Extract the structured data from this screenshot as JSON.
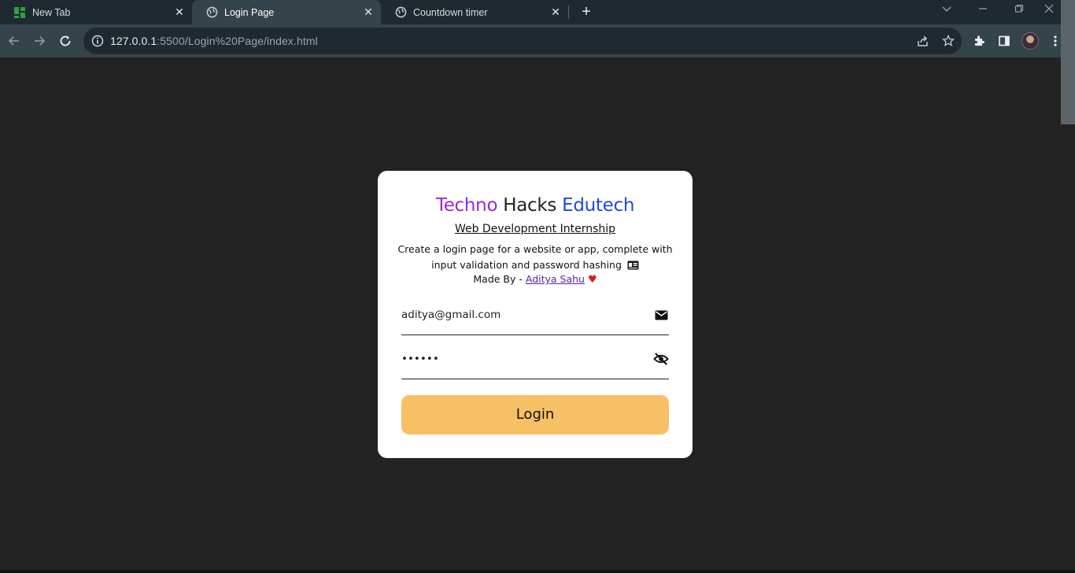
{
  "browser": {
    "tabs": [
      {
        "title": "New Tab",
        "icon": "grid-icon"
      },
      {
        "title": "Login Page",
        "icon": "globe-icon",
        "active": true
      },
      {
        "title": "Countdown timer",
        "icon": "globe-icon"
      }
    ],
    "new_tab_label": "+",
    "url_host": "127.0.0.1",
    "url_rest": ":5500/Login%20Page/index.html"
  },
  "card": {
    "title_part1": "Techno",
    "title_part2": "Hacks",
    "title_part3": "Edutech",
    "subtitle": "Web Development Internship",
    "description": "Create a login page for a website or app, complete with input validation and password hashing",
    "made_by_prefix": "Made By -",
    "author": "Aditya Sahu",
    "email_value": "aditya@gmail.com",
    "password_value": "••••••",
    "login_label": "Login"
  },
  "colors": {
    "background": "#222222",
    "card": "#ffffff",
    "techno": "#9b28d6",
    "edutech": "#1e49d8",
    "button": "#f8c064"
  }
}
